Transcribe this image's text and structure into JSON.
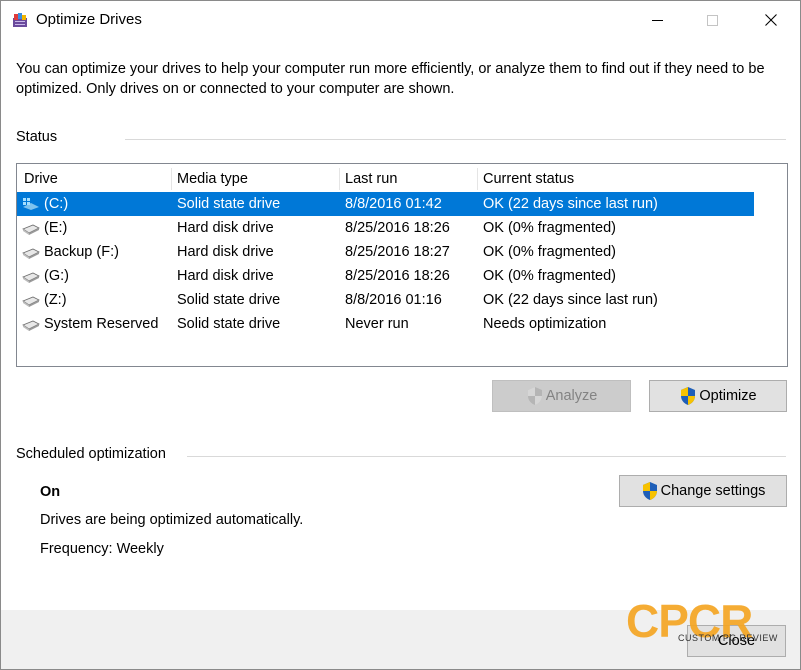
{
  "window": {
    "title": "Optimize Drives"
  },
  "description": "You can optimize your drives to help your computer run more efficiently, or analyze them to find out if they need to be optimized. Only drives on or connected to your computer are shown.",
  "status_label": "Status",
  "columns": [
    "Drive",
    "Media type",
    "Last run",
    "Current status"
  ],
  "drives": [
    {
      "drive": "(C:)",
      "media": "Solid state drive",
      "last_run": "8/8/2016 01:42",
      "status": "OK (22 days since last run)",
      "selected": true,
      "icon": "windows-drive-icon"
    },
    {
      "drive": "(E:)",
      "media": "Hard disk drive",
      "last_run": "8/25/2016 18:26",
      "status": "OK (0% fragmented)",
      "icon": "drive-icon"
    },
    {
      "drive": "Backup (F:)",
      "media": "Hard disk drive",
      "last_run": "8/25/2016 18:27",
      "status": "OK (0% fragmented)",
      "icon": "drive-icon"
    },
    {
      "drive": "(G:)",
      "media": "Hard disk drive",
      "last_run": "8/25/2016 18:26",
      "status": "OK (0% fragmented)",
      "icon": "drive-icon"
    },
    {
      "drive": "(Z:)",
      "media": "Solid state drive",
      "last_run": "8/8/2016 01:16",
      "status": "OK (22 days since last run)",
      "icon": "drive-icon"
    },
    {
      "drive": "System Reserved",
      "media": "Solid state drive",
      "last_run": "Never run",
      "status": "Needs optimization",
      "icon": "drive-icon"
    }
  ],
  "buttons": {
    "analyze": "Analyze",
    "optimize": "Optimize",
    "change_settings": "Change settings",
    "close": "Close"
  },
  "scheduled": {
    "label": "Scheduled optimization",
    "state": "On",
    "description": "Drives are being optimized automatically.",
    "frequency": "Frequency: Weekly"
  },
  "watermark": {
    "logo": "CPCR",
    "subtitle": "CUSTOM PC REVIEW"
  },
  "colors": {
    "selection": "#0078d7",
    "button_bg": "#e1e1e1",
    "footer_bg": "#f0f0f0",
    "watermark": "#f5a623"
  }
}
